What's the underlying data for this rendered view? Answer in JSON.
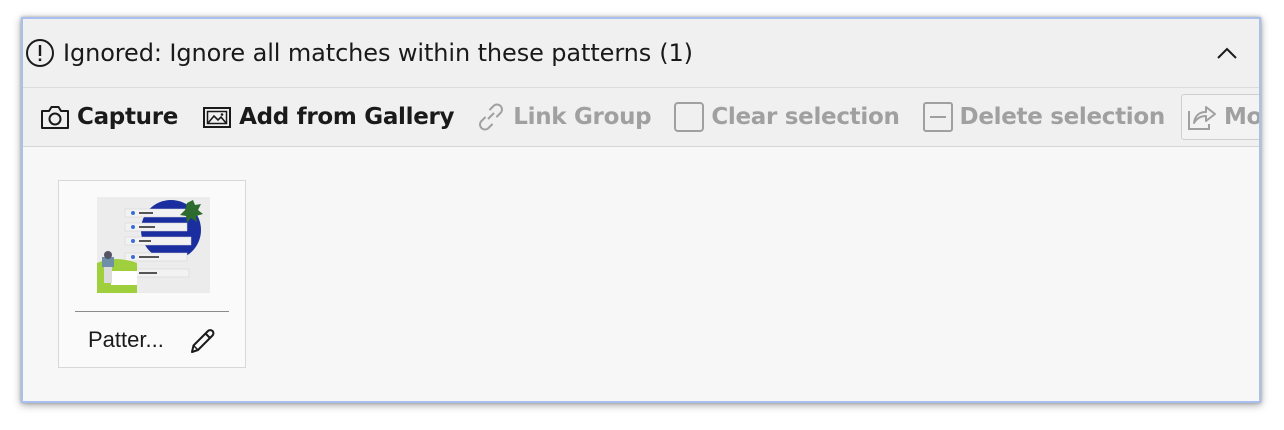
{
  "section": {
    "title": "Ignored: Ignore all matches within these patterns",
    "count": "(1)"
  },
  "toolbar": {
    "capture_label": "Capture",
    "gallery_label": "Add from Gallery",
    "link_group_label": "Link Group",
    "clear_selection_label": "Clear selection",
    "delete_selection_label": "Delete selection",
    "move_label": "Move"
  },
  "patterns": [
    {
      "name": "Patter..."
    }
  ],
  "icons": {
    "warning": "exclamation-circle-icon",
    "collapse": "chevron-up-icon",
    "capture": "camera-icon",
    "gallery": "image-icon",
    "link": "link-icon",
    "clear": "checkbox-icon",
    "delete": "minus-square-icon",
    "move": "share-icon",
    "edit": "pencil-icon"
  },
  "colors": {
    "accent_border": "#a9c0ec",
    "disabled_text": "#a0a0a0",
    "thumb_circle": "#1a2ea0"
  }
}
